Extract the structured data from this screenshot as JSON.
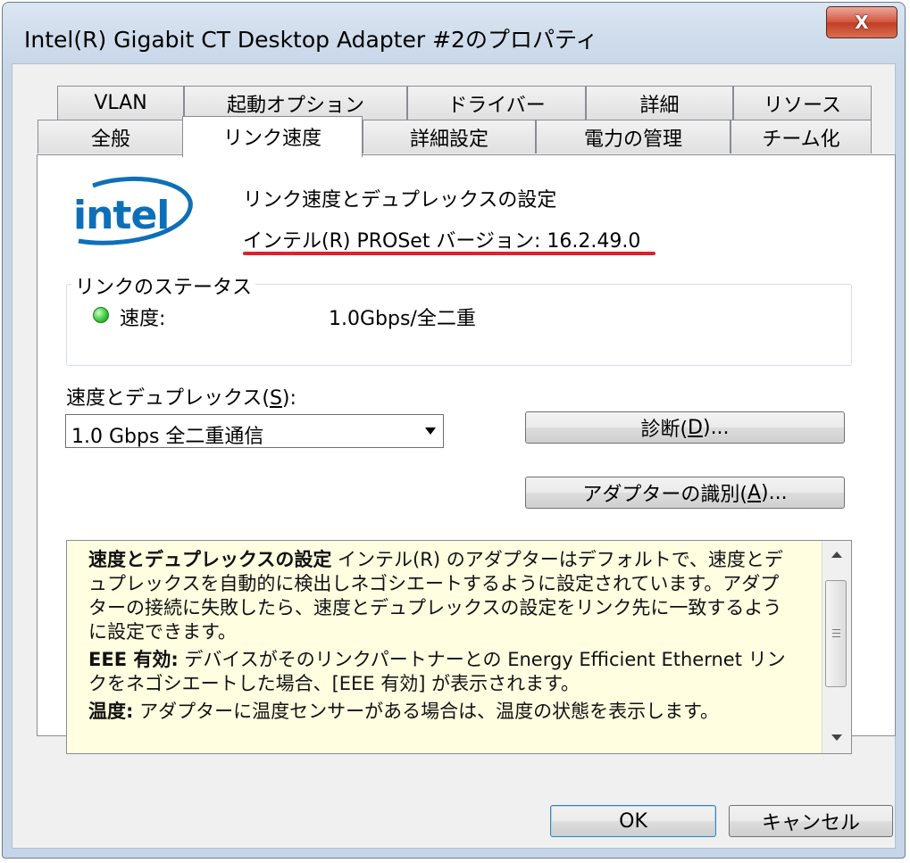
{
  "window": {
    "title": "Intel(R) Gigabit CT Desktop Adapter #2のプロパティ",
    "close_glyph": "X"
  },
  "tabs": {
    "top_row": [
      "VLAN",
      "起動オプション",
      "ドライバー",
      "詳細",
      "リソース"
    ],
    "bottom_row": [
      "全般",
      "リンク速度",
      "詳細設定",
      "電力の管理",
      "チーム化"
    ],
    "active": "リンク速度"
  },
  "header": {
    "logo_text": "intel",
    "heading": "リンク速度とデュプレックスの設定",
    "version_label": "インテル(R) PROSet バージョン:",
    "version_value": "16.2.49.0",
    "annotation_color": "#e0202a"
  },
  "link_status": {
    "group_label": "リンクのステータス",
    "speed_label": "速度:",
    "speed_value": "1.0Gbps/全二重",
    "led_color": "#3cc83c"
  },
  "speed_duplex": {
    "label_prefix": "速度とデュプレックス(",
    "label_key": "S",
    "label_suffix": "):",
    "selected": "1.0 Gbps 全二重通信"
  },
  "buttons": {
    "diagnose_prefix": "診断(",
    "diagnose_key": "D",
    "diagnose_suffix": ")...",
    "identify_prefix": "アダプターの識別(",
    "identify_key": "A",
    "identify_suffix": ")...",
    "ok": "OK",
    "cancel": "キャンセル"
  },
  "info": {
    "p1_bold": "速度とデュプレックスの設定",
    "p1_text": " インテル(R) のアダプターはデフォルトで、速度とデュプレックスを自動的に検出しネゴシエートするように設定されています。アダプターの接続に失敗したら、速度とデュプレックスの設定をリンク先に一致するように設定できます。",
    "p2_bold": "EEE 有効:",
    "p2_text": " デバイスがそのリンクパートナーとの Energy Efficient Ethernet リンクをネゴシエートした場合、[EEE 有効] が表示されます。",
    "p3_bold": "温度:",
    "p3_text": " アダプターに温度センサーがある場合は、温度の状態を表示します。",
    "background": "#fffee1"
  }
}
